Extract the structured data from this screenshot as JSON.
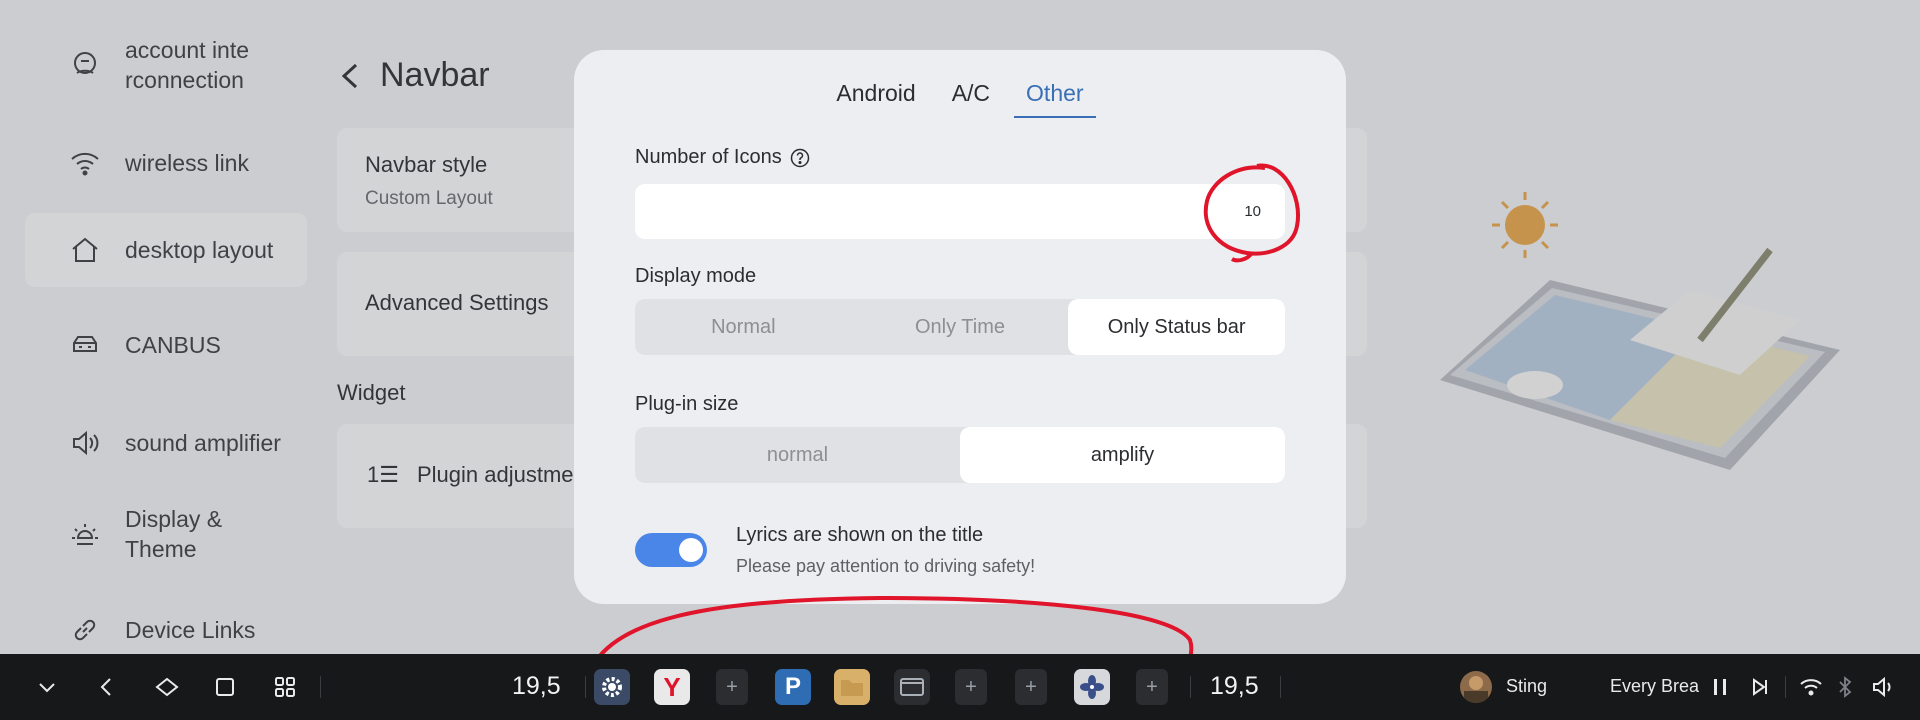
{
  "sidebar": {
    "items": [
      {
        "label": "account inte rconnection",
        "icon": "account-link-icon"
      },
      {
        "label": "wireless link",
        "icon": "wifi-icon"
      },
      {
        "label": "desktop layout",
        "icon": "home-icon",
        "active": true
      },
      {
        "label": "CANBUS",
        "icon": "car-icon"
      },
      {
        "label": "sound amplifier",
        "icon": "speaker-icon"
      },
      {
        "label": "Display & Theme",
        "icon": "brightness-icon"
      },
      {
        "label": "Device Links",
        "icon": "link-icon"
      }
    ]
  },
  "page": {
    "title": "Navbar",
    "navbar_style": {
      "title": "Navbar style",
      "value": "Custom Layout"
    },
    "advanced": {
      "title": "Advanced Settings"
    },
    "widget_section": "Widget",
    "plugin_adjust": {
      "title": "Plugin adjustme"
    }
  },
  "dialog": {
    "tabs": [
      "Android",
      "A/C",
      "Other"
    ],
    "active_tab": "Other",
    "icons": {
      "label": "Number of Icons",
      "value": "10"
    },
    "display_mode": {
      "label": "Display mode",
      "options": [
        "Normal",
        "Only Time",
        "Only Status bar"
      ],
      "selected": "Only Status bar"
    },
    "plugin_size": {
      "label": "Plug-in size",
      "options": [
        "normal",
        "amplify"
      ],
      "selected": "amplify"
    },
    "lyrics": {
      "title": "Lyrics are shown on the title",
      "subtitle": "Please pay attention to driving safety!",
      "enabled": true
    }
  },
  "taskbar": {
    "time_left": "19,5",
    "time_right": "19,5",
    "artist": "Sting",
    "song": "Every Brea",
    "apps": [
      "settings-icon",
      "yandex-icon",
      "add-icon",
      "parking-icon",
      "folder-icon",
      "screen-icon",
      "add-icon",
      "add-icon",
      "fan-icon",
      "add-icon"
    ]
  },
  "colors": {
    "accent": "#3a6fb5",
    "toggle": "#4a86e8",
    "annotation": "#e0142a",
    "taskbar": "#17181a"
  }
}
